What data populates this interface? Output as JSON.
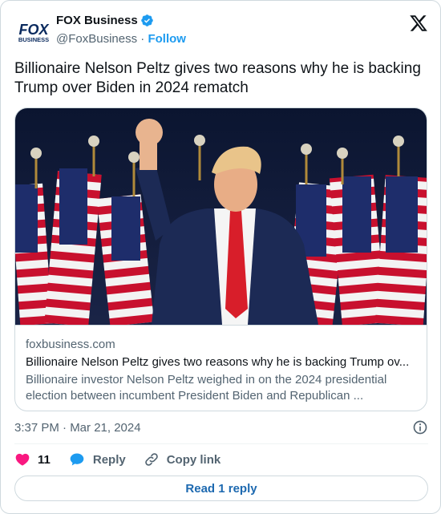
{
  "author": {
    "display_name": "FOX Business",
    "handle": "@FoxBusiness",
    "separator": " · ",
    "follow_label": "Follow",
    "logo_text_top": "FOX",
    "logo_text_bottom": "BUSINESS"
  },
  "tweet": {
    "text": "Billionaire Nelson Peltz gives two reasons why he is backing Trump over Biden in 2024 rematch",
    "timestamp": "3:37 PM · Mar 21, 2024"
  },
  "link_card": {
    "domain": "foxbusiness.com",
    "title": "Billionaire Nelson Peltz gives two reasons why he is backing Trump ov...",
    "description": "Billionaire investor Nelson Peltz weighed in on the 2024 presidential election between incumbent President Biden and Republican ..."
  },
  "actions": {
    "like_count": "11",
    "reply_label": "Reply",
    "copy_link_label": "Copy link"
  },
  "read_replies_label": "Read 1 reply",
  "colors": {
    "accent": "#1d9bf0",
    "like": "#f91880",
    "secondary_text": "#536471",
    "border": "#cfd9de"
  }
}
